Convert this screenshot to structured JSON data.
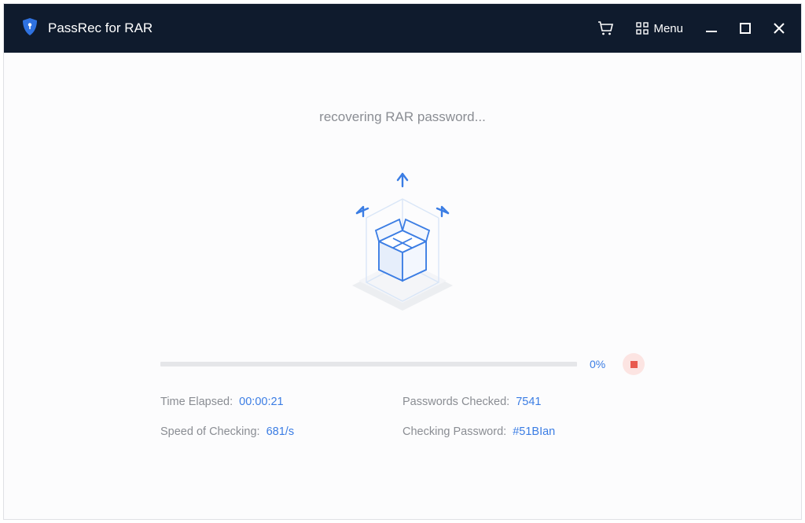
{
  "app": {
    "title": "PassRec for RAR"
  },
  "menu": {
    "label": "Menu"
  },
  "status": {
    "text": "recovering RAR password..."
  },
  "progress": {
    "percent_text": "0%",
    "percent_value": "0"
  },
  "stats": {
    "time_elapsed": {
      "label": "Time Elapsed:",
      "value": "00:00:21"
    },
    "passwords_checked": {
      "label": "Passwords Checked:",
      "value": "7541"
    },
    "speed": {
      "label": "Speed of Checking:",
      "value": "681/s"
    },
    "checking_password": {
      "label": "Checking Password:",
      "value": "#51BIan"
    }
  },
  "colors": {
    "accent": "#3b7de4",
    "titlebar": "#0f1b2d",
    "muted": "#8a8d93",
    "stop_bg": "#fce4e2",
    "stop_fg": "#e85a4f"
  }
}
